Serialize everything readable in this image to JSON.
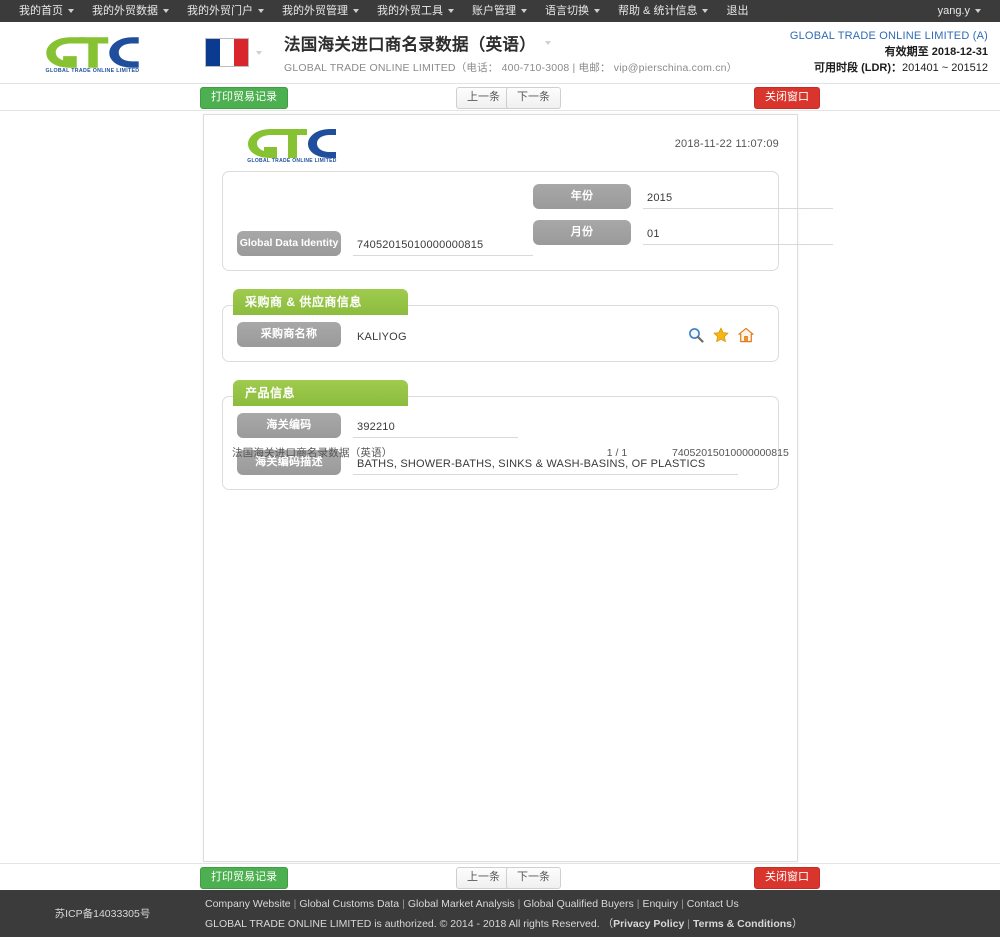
{
  "topnav": {
    "items": [
      {
        "label": "我的首页",
        "caret": true
      },
      {
        "label": "我的外贸数据",
        "caret": true
      },
      {
        "label": "我的外贸门户",
        "caret": true
      },
      {
        "label": "我的外贸管理",
        "caret": true
      },
      {
        "label": "我的外贸工具",
        "caret": true
      },
      {
        "label": "账户管理",
        "caret": true
      },
      {
        "label": "语言切换",
        "caret": true
      },
      {
        "label": "帮助 & 统计信息",
        "caret": true
      },
      {
        "label": "退出",
        "caret": false
      }
    ],
    "user": "yang.y"
  },
  "header": {
    "logo_text": "GLOBAL TRADE ONLINE LIMITED",
    "flag": "france-flag",
    "title": "法国海关进口商名录数据（英语）",
    "subtitle": "GLOBAL TRADE ONLINE LIMITED（电话： 400-710-3008 | 电邮： vip@pierschina.com.cn）",
    "account": {
      "company": "GLOBAL TRADE ONLINE LIMITED (A)",
      "expiry_label": "有效期至",
      "expiry_value": "2018-12-31",
      "range_label": "可用时段 (LDR)：",
      "range_value": "201401 ~ 201512"
    }
  },
  "toolbar": {
    "print_label": "打印贸易记录",
    "prev_label": "上一条",
    "next_label": "下一条",
    "close_label": "关闭窗口"
  },
  "document": {
    "timestamp": "2018-11-22 11:07:09",
    "identity": {
      "id_label": "Global Data Identity",
      "id_value": "74052015010000000815",
      "year_label": "年份",
      "year_value": "2015",
      "month_label": "月份",
      "month_value": "01"
    },
    "buyer_section": {
      "title": "采购商 & 供应商信息",
      "name_label": "采购商名称",
      "name_value": "KALIYOG",
      "icons": [
        "search-icon",
        "star-icon",
        "home-icon"
      ]
    },
    "product_section": {
      "title": "产品信息",
      "hs_code_label": "海关编码",
      "hs_code_value": "392210",
      "hs_desc_label": "海关编码描述",
      "hs_desc_value": "BATHS, SHOWER-BATHS, SINKS & WASH-BASINS, OF PLASTICS"
    },
    "footer": {
      "source": "法国海关进口商名录数据（英语）",
      "page": "1 / 1",
      "record_id": "74052015010000000815"
    }
  },
  "pagefooter": {
    "icp": "苏ICP备14033305号",
    "links": [
      "Company Website",
      "Global Customs Data",
      "Global Market Analysis",
      "Global Qualified Buyers",
      "Enquiry",
      "Contact Us"
    ],
    "copyright": "GLOBAL TRADE ONLINE LIMITED is authorized. © 2014 - 2018 All rights Reserved.",
    "legal_open": "（",
    "privacy": "Privacy Policy",
    "legal_sep": "|",
    "terms": "Terms & Conditions",
    "legal_close": "）"
  },
  "colors": {
    "green": "#4caf50",
    "red": "#d9352c",
    "section_green": "#9fcb4e",
    "nav_dark": "#3b3b3b",
    "link_blue": "#2f6bb5"
  }
}
